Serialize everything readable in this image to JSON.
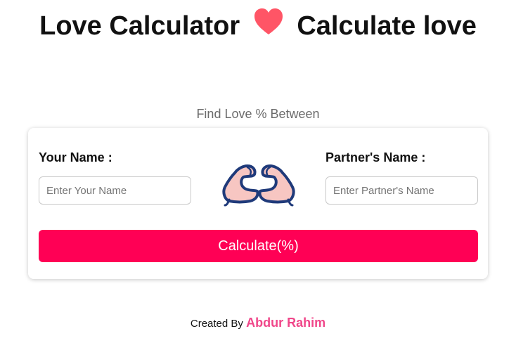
{
  "header": {
    "title_left": "Love Calculator",
    "title_right": "Calculate love"
  },
  "main": {
    "subtitle": "Find Love % Between",
    "your_name_label": "Your Name :",
    "your_name_value": "",
    "your_name_placeholder": "Enter Your Name",
    "partner_name_label": "Partner's Name :",
    "partner_name_value": "",
    "partner_name_placeholder": "Enter Partner's Name",
    "calculate_label": "Calculate(%)"
  },
  "footer": {
    "created_by": "Created By",
    "author": "Abdur Rahim"
  },
  "icons": {
    "title_heart": "heart-icon",
    "center_image": "heart-hands-icon"
  },
  "colors": {
    "accent": "#ff0055",
    "heart": "#ff5566",
    "author": "#f0478a",
    "hands_fill": "#f7c6c2",
    "hands_outline": "#1f3a7a"
  }
}
